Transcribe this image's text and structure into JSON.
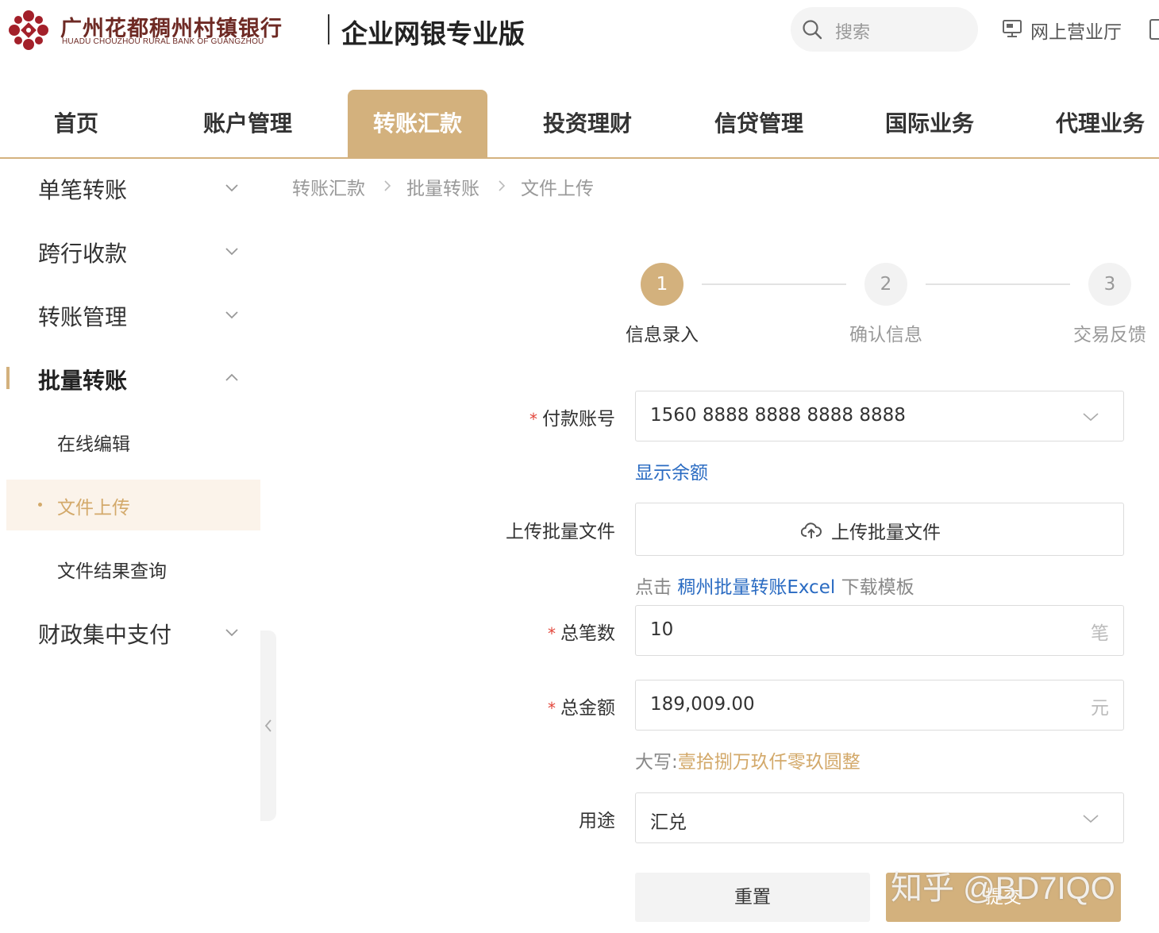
{
  "header": {
    "bank_name_cn": "广州花都稠州村镇银行",
    "bank_name_en": "HUADU CHOUZHOU RURAL BANK OF GUANGZHOU",
    "product_name": "企业网银专业版",
    "search_placeholder": "搜索",
    "online_hall_label": "网上营业厅",
    "brand_color": "#6e2a24"
  },
  "main_nav": {
    "accent_color": "#d3b17d",
    "active_index": 2,
    "items": [
      {
        "label": "首页"
      },
      {
        "label": "账户管理"
      },
      {
        "label": "转账汇款"
      },
      {
        "label": "投资理财"
      },
      {
        "label": "信贷管理"
      },
      {
        "label": "国际业务"
      },
      {
        "label": "代理业务"
      }
    ]
  },
  "sidebar": {
    "items": [
      {
        "label": "单笔转账",
        "expanded": false
      },
      {
        "label": "跨行收款",
        "expanded": false
      },
      {
        "label": "转账管理",
        "expanded": false
      },
      {
        "label": "批量转账",
        "expanded": true
      },
      {
        "label": "财政集中支付",
        "expanded": false
      }
    ],
    "sub_items": [
      {
        "label": "在线编辑"
      },
      {
        "label": "文件上传",
        "active": true
      },
      {
        "label": "文件结果查询"
      }
    ]
  },
  "breadcrumb": [
    "转账汇款",
    "批量转账",
    "文件上传"
  ],
  "steps": {
    "current": 1,
    "items": [
      {
        "number": "1",
        "label": "信息录入"
      },
      {
        "number": "2",
        "label": "确认信息"
      },
      {
        "number": "3",
        "label": "交易反馈"
      }
    ]
  },
  "form": {
    "payer_account": {
      "label": "付款账号",
      "required": true,
      "value": "1560 8888 8888 8888 8888"
    },
    "show_balance_link": "显示余额",
    "upload": {
      "label": "上传批量文件",
      "button_label": "上传批量文件"
    },
    "template_hint": {
      "prefix": "点击",
      "link": "稠州批量转账Excel",
      "suffix": "下载模板"
    },
    "total_count": {
      "label": "总笔数",
      "required": true,
      "value": "10",
      "unit": "笔"
    },
    "total_amount": {
      "label": "总金额",
      "required": true,
      "value": "189,009.00",
      "unit": "元"
    },
    "amount_in_words": {
      "prefix": "大写:",
      "value": "壹拾捌万玖仟零玖圆整"
    },
    "purpose": {
      "label": "用途",
      "value": "汇兑"
    },
    "reset_label": "重置",
    "submit_label": "提交"
  },
  "watermark": "知乎 @BD7IQO"
}
